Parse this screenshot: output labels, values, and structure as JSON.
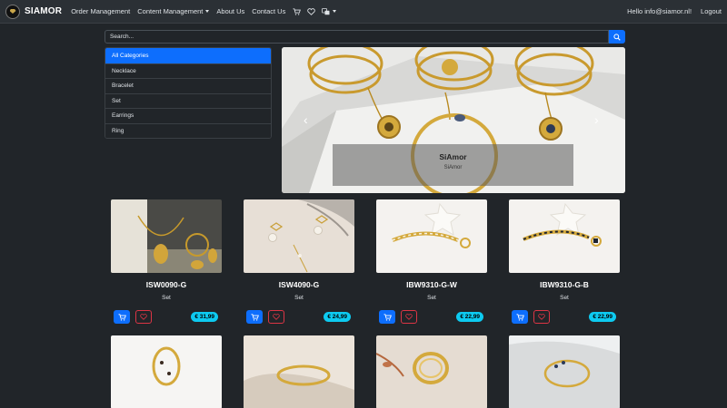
{
  "nav": {
    "brand": "SIAMOR",
    "links": [
      "Order Management",
      "Content Management",
      "About Us",
      "Contact Us"
    ],
    "greeting": "Hello info@siamor.nl!",
    "logout": "Logout",
    "icons": [
      "cart-icon",
      "heart-icon",
      "language-icon"
    ]
  },
  "search": {
    "placeholder": "Search..."
  },
  "categories": [
    "All Categories",
    "Necklace",
    "Bracelet",
    "Set",
    "Earrings",
    "Ring"
  ],
  "carousel": {
    "title": "SiAmor",
    "subtitle": "SiAmor",
    "prev": "‹",
    "next": "›",
    "slides_visible": 4,
    "active_slide": 1
  },
  "products": [
    {
      "code": "ISW0090-G",
      "category": "Set",
      "price": "€ 31,99"
    },
    {
      "code": "ISW4090-G",
      "category": "Set",
      "price": "€ 24,99"
    },
    {
      "code": "IBW9310-G-W",
      "category": "Set",
      "price": "€ 22,99"
    },
    {
      "code": "IBW9310-G-B",
      "category": "Set",
      "price": "€ 22,99"
    }
  ],
  "colors": {
    "primary": "#0d6efd",
    "price_badge": "#0dcaf0",
    "favorite": "#dc3545",
    "background": "#212529",
    "navbar": "#2b3035"
  }
}
